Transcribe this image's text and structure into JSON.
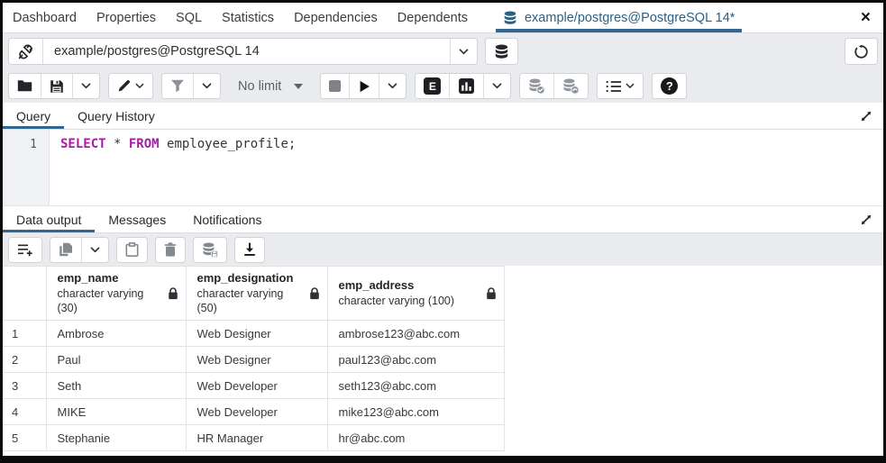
{
  "colors": {
    "accent": "#326690",
    "keyword": "#a61ca3",
    "toolbar_bg": "#e9ebee"
  },
  "tab_bar": {
    "tabs": [
      "Dashboard",
      "Properties",
      "SQL",
      "Statistics",
      "Dependencies",
      "Dependents"
    ],
    "active_tab": "example/postgres@PostgreSQL 14*",
    "close": "×"
  },
  "connection_bar": {
    "value": "example/postgres@PostgreSQL 14"
  },
  "toolbar": {
    "limit": "No limit",
    "explain_label": "E",
    "help_label": "?"
  },
  "query_panel": {
    "tabs": [
      "Query",
      "Query History"
    ],
    "line_number": "1",
    "sql": {
      "select": "SELECT",
      "star": " * ",
      "from": "FROM",
      "rest": " employee_profile;"
    }
  },
  "output_panel": {
    "tabs": [
      "Data output",
      "Messages",
      "Notifications"
    ]
  },
  "results_table": {
    "columns": [
      {
        "name": "emp_name",
        "type": "character varying (30)"
      },
      {
        "name": "emp_designation",
        "type": "character varying (50)"
      },
      {
        "name": "emp_address",
        "type": "character varying (100)"
      }
    ],
    "rows": [
      {
        "num": "1",
        "name": "Ambrose",
        "designation": "Web Designer",
        "address": "ambrose123@abc.com"
      },
      {
        "num": "2",
        "name": "Paul",
        "designation": "Web Designer",
        "address": "paul123@abc.com"
      },
      {
        "num": "3",
        "name": "Seth",
        "designation": "Web Developer",
        "address": "seth123@abc.com"
      },
      {
        "num": "4",
        "name": "MIKE",
        "designation": "Web Developer",
        "address": "mike123@abc.com"
      },
      {
        "num": "5",
        "name": "Stephanie",
        "designation": "HR Manager",
        "address": "hr@abc.com"
      }
    ]
  },
  "icons": {
    "active_tab": "database-icon",
    "connect": "plug-icon",
    "new_connection": "database-icon",
    "refresh": "refresh-icon",
    "open_file": "folder-icon",
    "save": "floppy-icon",
    "edit": "pencil-icon",
    "filter": "funnel-icon",
    "stop": "stop-icon",
    "execute": "play-icon",
    "explain": "explain-e-badge",
    "explain_analyze": "bar-chart-icon",
    "commit": "database-check-icon",
    "rollback": "database-rollback-icon",
    "macros": "ordered-list-icon",
    "help": "question-mark-icon",
    "add_row": "add-row-icon",
    "copy": "copy-icon",
    "paste": "clipboard-icon",
    "delete": "trash-icon",
    "save_data": "database-save-icon",
    "download": "download-icon",
    "expand": "expand-diagonal-icon",
    "lock": "lock-icon",
    "close": "close-icon",
    "chevron": "chevron-down-icon"
  }
}
